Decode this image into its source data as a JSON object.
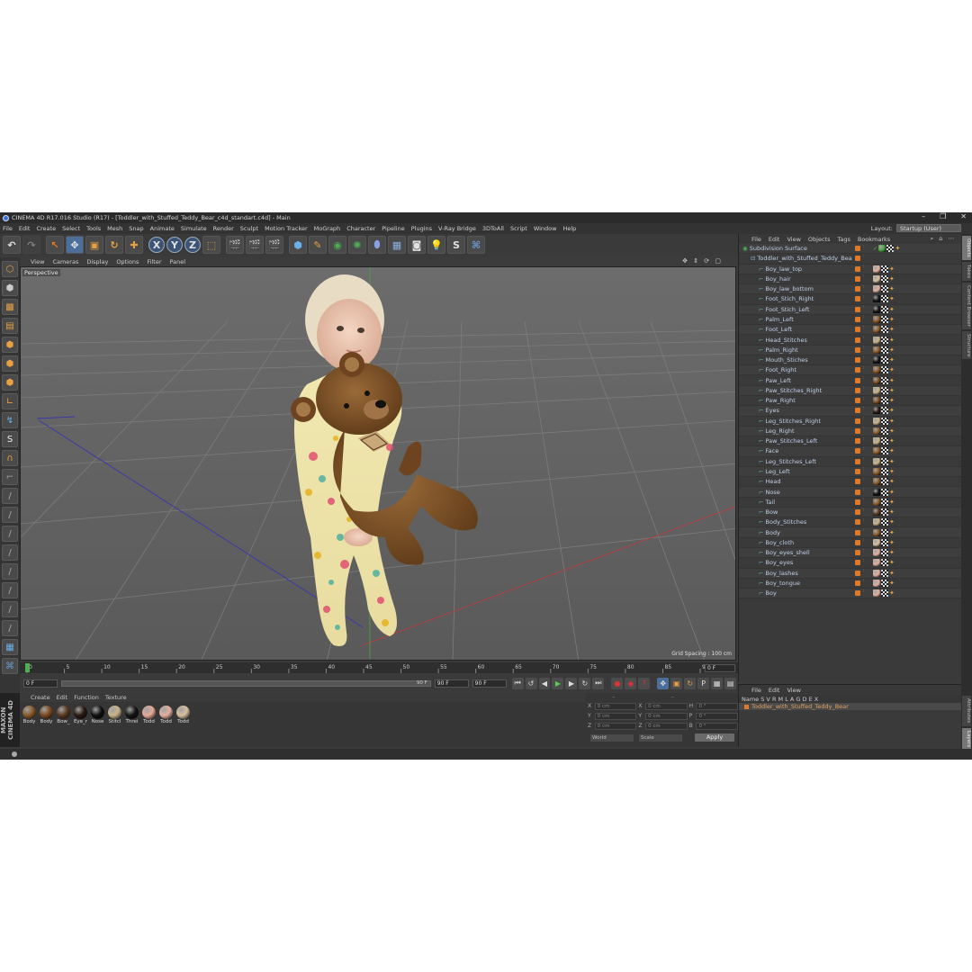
{
  "window": {
    "title": "CINEMA 4D R17.016 Studio (R17) - [Toddler_with_Stuffed_Teddy_Bear_c4d_standart.c4d] - Main",
    "controls": [
      "–",
      "❐",
      "✕"
    ]
  },
  "menubar": [
    "File",
    "Edit",
    "Create",
    "Select",
    "Tools",
    "Mesh",
    "Snap",
    "Animate",
    "Simulate",
    "Render",
    "Sculpt",
    "Motion Tracker",
    "MoGraph",
    "Character",
    "Pipeline",
    "Plugins",
    "V-Ray Bridge",
    "3DToAll",
    "Script",
    "Window",
    "Help"
  ],
  "layout": {
    "label": "Layout:",
    "value": "Startup (User)"
  },
  "viewport": {
    "menu": [
      "View",
      "Cameras",
      "Display",
      "Options",
      "Filter",
      "Panel"
    ],
    "label": "Perspective",
    "grid_spacing": "Grid Spacing : 100 cm",
    "nav_icons": "✥ ⇕ ⟳ ▢"
  },
  "timeline": {
    "ticks": [
      "0",
      "5",
      "10",
      "15",
      "20",
      "25",
      "30",
      "35",
      "40",
      "45",
      "50",
      "55",
      "60",
      "65",
      "70",
      "75",
      "80",
      "85",
      "90"
    ],
    "current_frame": "0 F",
    "start": "0 F",
    "end": "90 F",
    "end2": "90 F",
    "range_label": "90 F"
  },
  "materials": {
    "menu": [
      "Create",
      "Edit",
      "Function",
      "Texture"
    ],
    "items": [
      {
        "label": "Body",
        "color": "#8a5a2a"
      },
      {
        "label": "Body",
        "color": "#7a4a22"
      },
      {
        "label": "Bow_",
        "color": "#5a3a20"
      },
      {
        "label": "Eye_r",
        "color": "#2a1a12"
      },
      {
        "label": "Nose",
        "color": "#111111"
      },
      {
        "label": "Stitcl",
        "color": "#c8b48a"
      },
      {
        "label": "Threi",
        "color": "#151515"
      },
      {
        "label": "Todd",
        "color": "#e8a898"
      },
      {
        "label": "Todd",
        "color": "#e4b0a0"
      },
      {
        "label": "Todd",
        "color": "#d8c0a0"
      }
    ]
  },
  "coords": {
    "rows": [
      {
        "a": "X",
        "av": "0 cm",
        "b": "X",
        "bv": "0 cm",
        "c": "H",
        "cv": "0 °"
      },
      {
        "a": "Y",
        "av": "0 cm",
        "b": "Y",
        "bv": "0 cm",
        "c": "P",
        "cv": "0 °"
      },
      {
        "a": "Z",
        "av": "0 cm",
        "b": "Z",
        "bv": "0 cm",
        "c": "B",
        "cv": "0 °"
      }
    ],
    "mode1": "World",
    "mode2": "Scale",
    "apply": "Apply"
  },
  "objects_panel": {
    "menu": [
      "File",
      "Edit",
      "View",
      "Objects",
      "Tags",
      "Bookmarks"
    ],
    "icons": "⌕ ⌂ ⋯",
    "items": [
      {
        "name": "Subdivision Surface",
        "indent": 0,
        "tag": "#4aa040"
      },
      {
        "name": "Toddler_with_Stuffed_Teddy_Bear",
        "indent": 1,
        "tag": ""
      },
      {
        "name": "Boy_law_top",
        "indent": 2,
        "tag": "#e4b0a0"
      },
      {
        "name": "Boy_hair",
        "indent": 2,
        "tag": "#d8c0a0"
      },
      {
        "name": "Boy_law_bottom",
        "indent": 2,
        "tag": "#e4b0a0"
      },
      {
        "name": "Foot_Stich_Right",
        "indent": 2,
        "tag": "#151515"
      },
      {
        "name": "Foot_Stich_Left",
        "indent": 2,
        "tag": "#151515"
      },
      {
        "name": "Palm_Left",
        "indent": 2,
        "tag": "#8a5a2a"
      },
      {
        "name": "Foot_Left",
        "indent": 2,
        "tag": "#8a5a2a"
      },
      {
        "name": "Head_Stitches",
        "indent": 2,
        "tag": "#c8b48a"
      },
      {
        "name": "Palm_Right",
        "indent": 2,
        "tag": "#8a5a2a"
      },
      {
        "name": "Mouth_Stiches",
        "indent": 2,
        "tag": "#151515"
      },
      {
        "name": "Foot_Right",
        "indent": 2,
        "tag": "#8a5a2a"
      },
      {
        "name": "Paw_Left",
        "indent": 2,
        "tag": "#7a4a22"
      },
      {
        "name": "Paw_Stitches_Right",
        "indent": 2,
        "tag": "#c8b48a"
      },
      {
        "name": "Paw_Right",
        "indent": 2,
        "tag": "#7a4a22"
      },
      {
        "name": "Eyes",
        "indent": 2,
        "tag": "#2a1a12"
      },
      {
        "name": "Leg_Stitches_Right",
        "indent": 2,
        "tag": "#c8b48a"
      },
      {
        "name": "Leg_Right",
        "indent": 2,
        "tag": "#8a5a2a"
      },
      {
        "name": "Paw_Stitches_Left",
        "indent": 2,
        "tag": "#c8b48a"
      },
      {
        "name": "Face",
        "indent": 2,
        "tag": "#8a5a2a"
      },
      {
        "name": "Leg_Stitches_Left",
        "indent": 2,
        "tag": "#c8b48a"
      },
      {
        "name": "Leg_Left",
        "indent": 2,
        "tag": "#8a5a2a"
      },
      {
        "name": "Head",
        "indent": 2,
        "tag": "#8a5a2a"
      },
      {
        "name": "Nose",
        "indent": 2,
        "tag": "#111111"
      },
      {
        "name": "Tail",
        "indent": 2,
        "tag": "#8a5a2a"
      },
      {
        "name": "Bow",
        "indent": 2,
        "tag": "#5a3a20"
      },
      {
        "name": "Body_Stitches",
        "indent": 2,
        "tag": "#c8b48a"
      },
      {
        "name": "Body",
        "indent": 2,
        "tag": "#8a5a2a"
      },
      {
        "name": "Boy_cloth",
        "indent": 2,
        "tag": "#d8c0a0"
      },
      {
        "name": "Boy_eyes_shell",
        "indent": 2,
        "tag": "#e4b0a0"
      },
      {
        "name": "Boy_eyes",
        "indent": 2,
        "tag": "#e4b0a0"
      },
      {
        "name": "Boy_lashes",
        "indent": 2,
        "tag": "#e4b0a0"
      },
      {
        "name": "Boy_tongue",
        "indent": 2,
        "tag": "#e4b0a0"
      },
      {
        "name": "Boy",
        "indent": 2,
        "tag": "#e4b0a0"
      }
    ]
  },
  "side_tabs": [
    "Objects",
    "Takes",
    "Content Browser",
    "Structure"
  ],
  "side_tabs2": [
    "Attributes",
    "Layers"
  ],
  "layers_panel": {
    "menu": [
      "File",
      "Edit",
      "View"
    ],
    "columns": "Name        S  V  R  M  L  A  G  D  E  X",
    "row": "Toddler_with_Stuffed_Teddy_Bear"
  },
  "maxon": "MAXON CINEMA 4D"
}
